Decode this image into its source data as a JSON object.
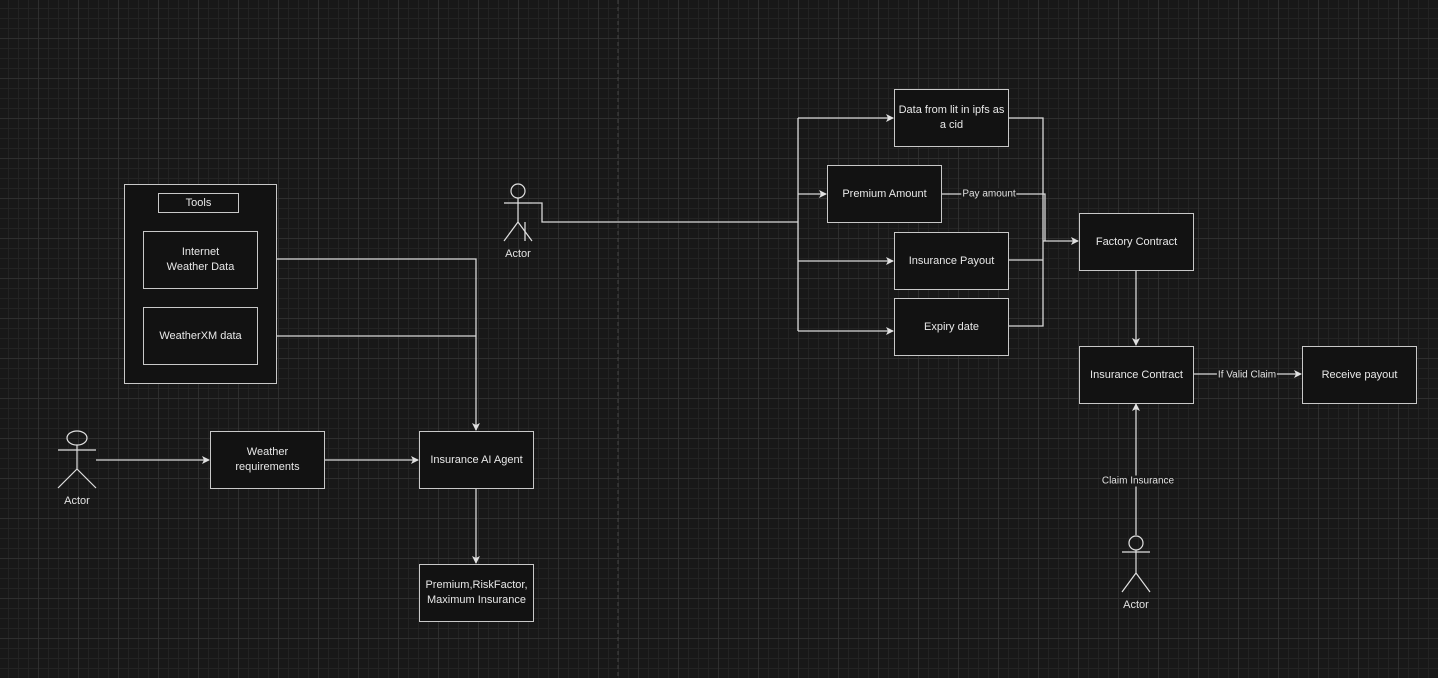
{
  "diagram": {
    "colors": {
      "background": "#181818",
      "stroke": "#c8c8c8",
      "node_fill": "#121212",
      "text": "#e8e8e8"
    },
    "nodes": {
      "tools_title": "Tools",
      "internet_weather": "Internet\nWeather Data",
      "weatherxm": "WeatherXM data",
      "weather_requirements": "Weather\nrequirements",
      "ai_agent": "Insurance AI Agent",
      "ai_output": "Premium,RiskFactor,\nMaximum Insurance",
      "lit_data": "Data from lit in ipfs as a cid",
      "premium_amount": "Premium Amount",
      "insurance_payout": "Insurance Payout",
      "expiry_date": "Expiry date",
      "factory_contract": "Factory Contract",
      "insurance_contract": "Insurance Contract",
      "receive_payout": "Receive payout"
    },
    "actors": [
      "Actor",
      "Actor",
      "Actor"
    ],
    "edge_labels": {
      "pay_amount": "Pay amount",
      "if_valid_claim": "If Valid Claim",
      "claim_insurance": "Claim Insurance"
    }
  }
}
